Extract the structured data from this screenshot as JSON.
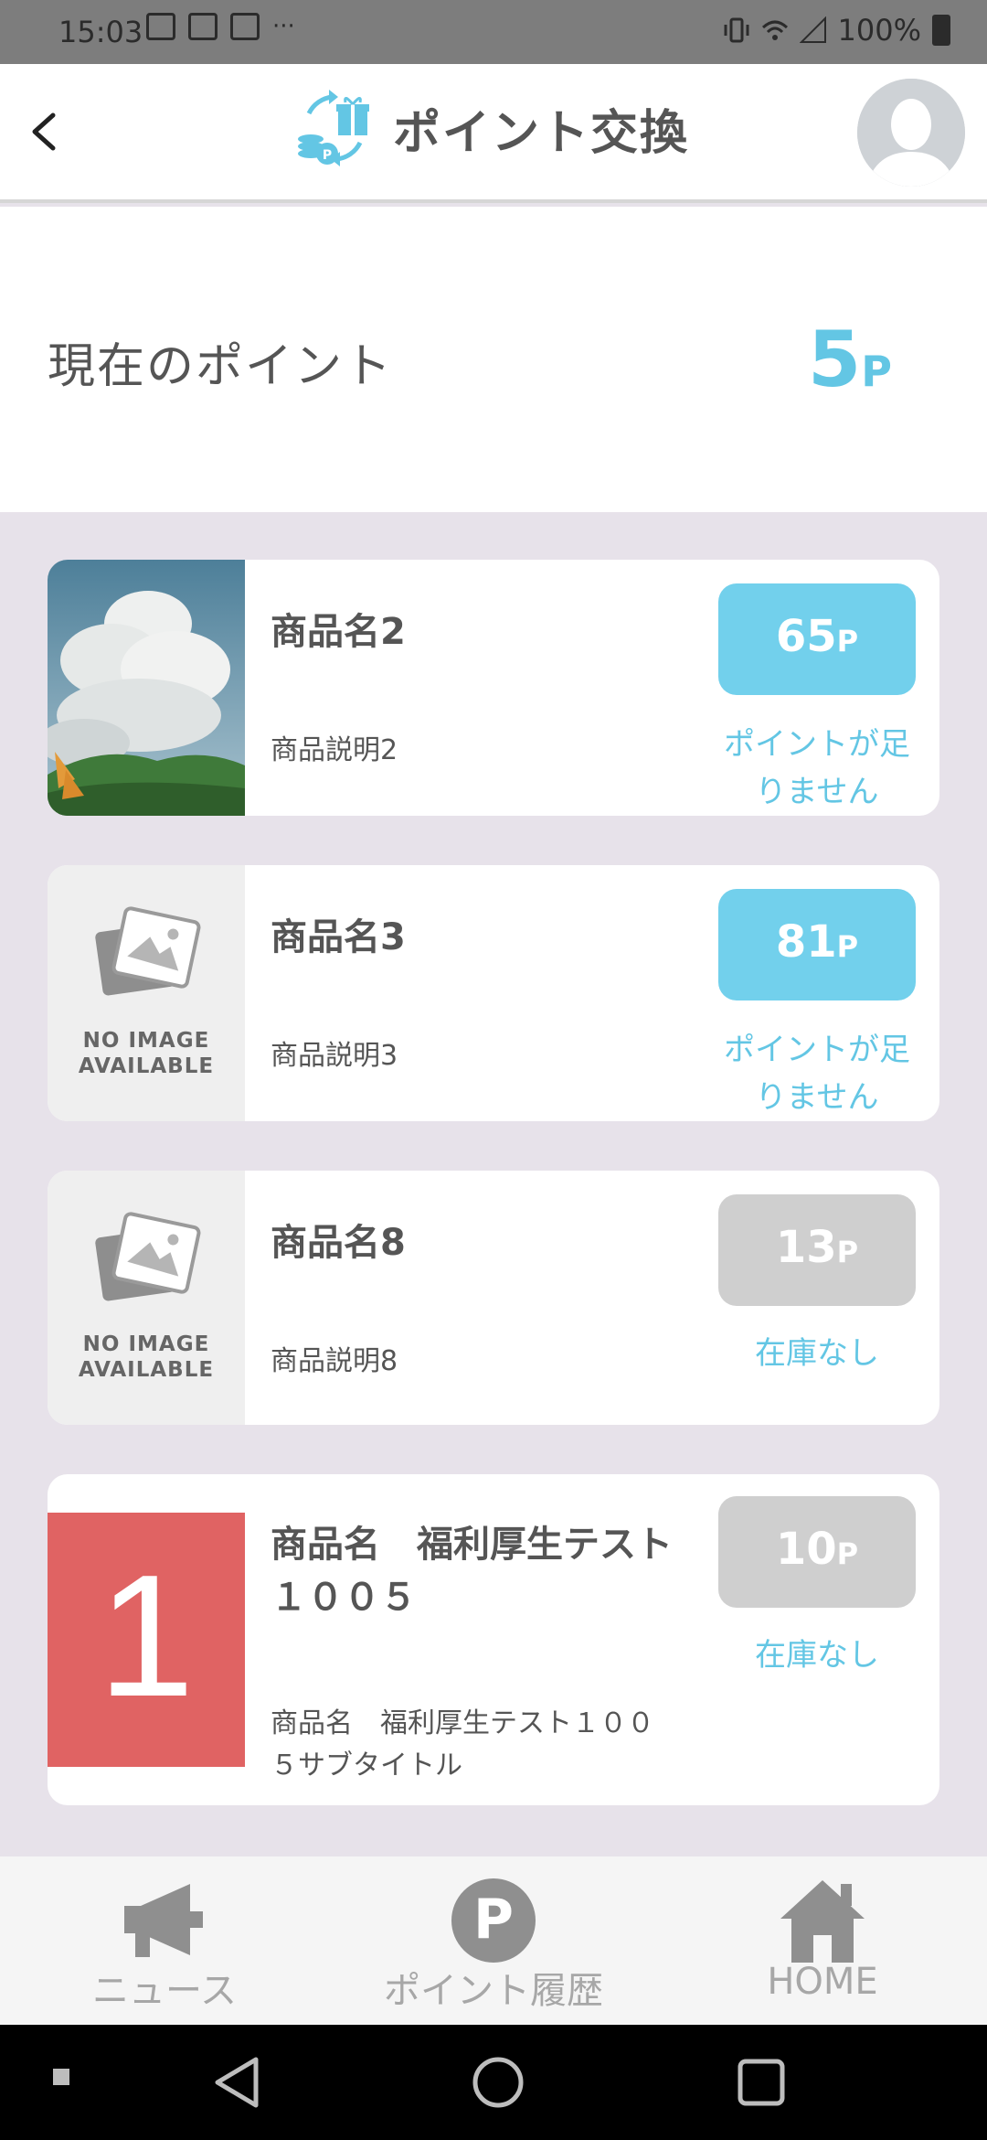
{
  "status_bar": {
    "time": "15:03",
    "dots": "···",
    "battery": "100%"
  },
  "header": {
    "back_icon": "chevron-left-icon",
    "title": "ポイント交換",
    "title_icon": "point-exchange-icon",
    "avatar_icon": "user-avatar-icon"
  },
  "current_points": {
    "label": "現在のポイント",
    "value": "5",
    "unit": "P"
  },
  "products": [
    {
      "name": "商品名2",
      "description": "商品説明2",
      "price": "65",
      "unit": "P",
      "status": "ポイントが足りません",
      "image": "sky-clouds-photo"
    },
    {
      "name": "商品名3",
      "description": "商品説明3",
      "price": "81",
      "unit": "P",
      "status": "ポイントが足りません",
      "image": "no-image"
    },
    {
      "name": "商品名8",
      "description": "商品説明8",
      "price": "13",
      "unit": "P",
      "status": "在庫なし",
      "image": "no-image"
    },
    {
      "name": "商品名　福利厚生テスト１００５",
      "description": "商品名　福利厚生テスト１００５サブタイトル",
      "price": "10",
      "unit": "P",
      "status": "在庫なし",
      "image": "red-number-1",
      "image_text": "1"
    }
  ],
  "no_image_text": {
    "line1": "NO IMAGE",
    "line2": "AVAILABLE"
  },
  "bottom_nav": [
    {
      "label": "ニュース",
      "icon": "megaphone-icon"
    },
    {
      "label": "ポイント履歴",
      "icon": "point-p-icon",
      "icon_text": "P"
    },
    {
      "label": "HOME",
      "icon": "home-icon"
    }
  ],
  "colors": {
    "accent": "#63c6e4",
    "button_active": "#72d0ec",
    "button_disabled": "#cfcfcf",
    "list_background": "#e7e2ea",
    "red_tile": "#e06363"
  }
}
